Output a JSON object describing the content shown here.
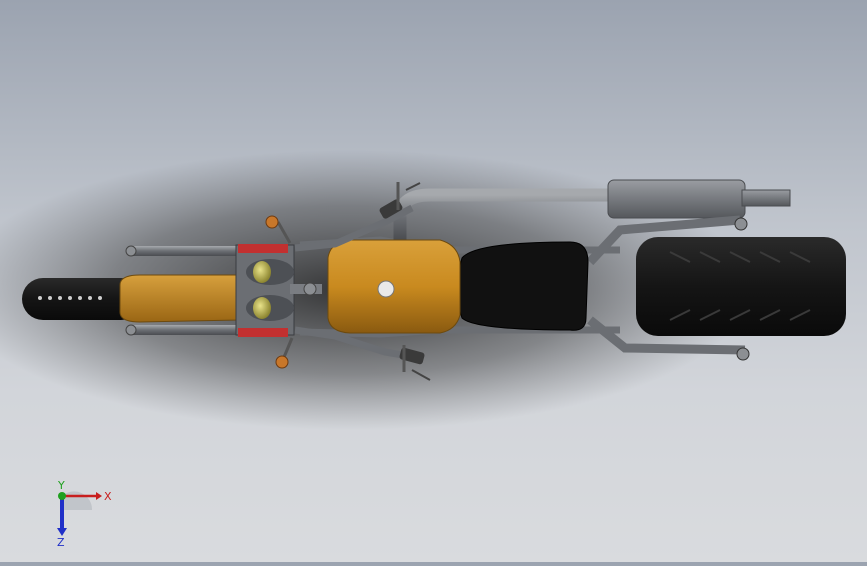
{
  "viewport": {
    "background_top": "#9ba3b0",
    "background_bottom": "#d9dbde",
    "model": "motorcycle-chopper-top-view"
  },
  "colors": {
    "tank": "#c98a1f",
    "tank_dark": "#8a5a10",
    "frame": "#6b6e73",
    "frame_light": "#9a9da2",
    "tire": "#151515",
    "seat": "#0e0e0e",
    "headlight_lens": "#c9c35a",
    "spring": "#c23030",
    "turn_signal": "#c8772a"
  },
  "triad": {
    "x_label": "X",
    "y_label": "Y",
    "z_label": "Z",
    "x_color": "#c81e1e",
    "y_color": "#1fa01f",
    "z_color": "#2030c8"
  }
}
